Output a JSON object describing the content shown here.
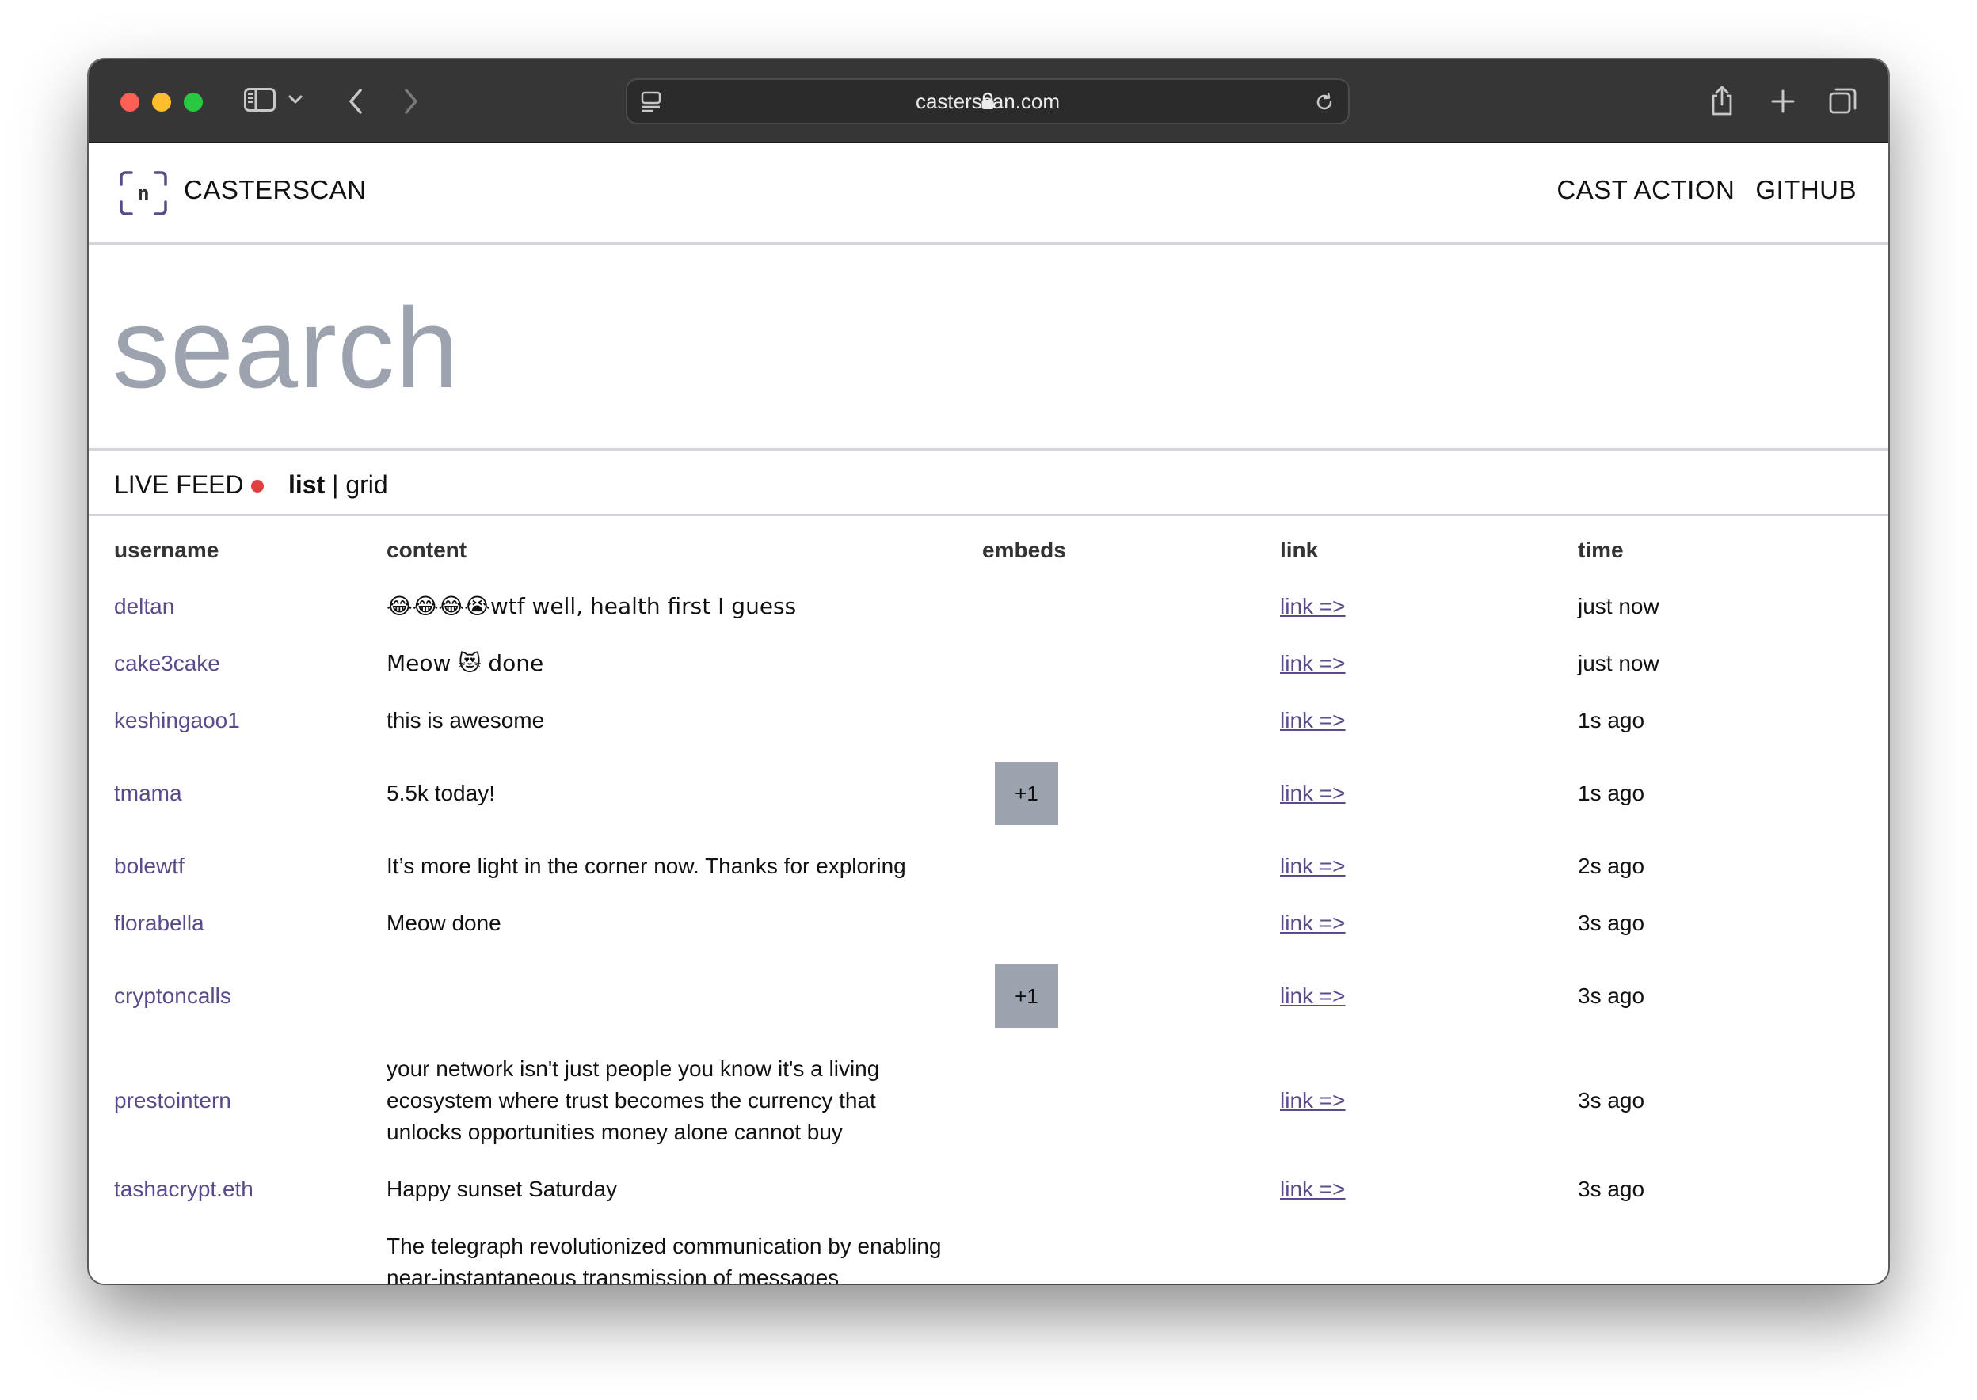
{
  "browser": {
    "url": "casterscan.com"
  },
  "site": {
    "brand": "CASTERSCAN",
    "nav": [
      "CAST ACTION",
      "GITHUB"
    ]
  },
  "search": {
    "placeholder": "search"
  },
  "feed": {
    "live_label": "LIVE FEED",
    "view_active": "list",
    "view_separator": "|",
    "view_other": "grid"
  },
  "table": {
    "headers": [
      "username",
      "content",
      "embeds",
      "link",
      "time"
    ],
    "rows": [
      {
        "username": "deltan",
        "content": "😂😂😂😭wtf well, health first I guess",
        "embeds": "",
        "link": "link =>",
        "time": "just now"
      },
      {
        "username": "cake3cake",
        "content": "Meow 😻 done",
        "embeds": "",
        "link": "link =>",
        "time": "just now"
      },
      {
        "username": "keshingaoo1",
        "content": "this is awesome",
        "embeds": "",
        "link": "link =>",
        "time": "1s ago"
      },
      {
        "username": "tmama",
        "content": "5.5k today!",
        "embeds": "+1",
        "link": "link =>",
        "time": "1s ago"
      },
      {
        "username": "bolewtf",
        "content": "It’s more light in the corner now. Thanks for exploring",
        "embeds": "",
        "link": "link =>",
        "time": "2s ago"
      },
      {
        "username": "florabella",
        "content": "Meow done",
        "embeds": "",
        "link": "link =>",
        "time": "3s ago"
      },
      {
        "username": "cryptoncalls",
        "content": "",
        "embeds": "+1",
        "link": "link =>",
        "time": "3s ago"
      },
      {
        "username": "prestointern",
        "content": "your network isn't just people you know it's a living ecosystem where trust becomes the currency that unlocks opportunities money alone cannot buy",
        "embeds": "",
        "link": "link =>",
        "time": "3s ago"
      },
      {
        "username": "tashacrypt.eth",
        "content": "Happy sunset Saturday",
        "embeds": "",
        "link": "link =>",
        "time": "3s ago"
      },
      {
        "username": "",
        "content": "The telegraph revolutionized communication by enabling near-instantaneous transmission of messages",
        "embeds": "",
        "link": "",
        "time": ""
      }
    ]
  },
  "colors": {
    "accent": "#5b4a8a",
    "live_dot": "#e53e3e",
    "placeholder": "#9ca3af",
    "embed_chip": "#9ca3af"
  },
  "icons": {
    "sidebar": "sidebar-icon",
    "back": "chevron-left-icon",
    "forward": "chevron-right-icon",
    "lock": "lock-icon",
    "reload": "reload-icon",
    "share": "share-icon",
    "new_tab": "plus-icon",
    "tabs": "tabs-overview-icon",
    "logo": "casterscan-logo-icon"
  }
}
